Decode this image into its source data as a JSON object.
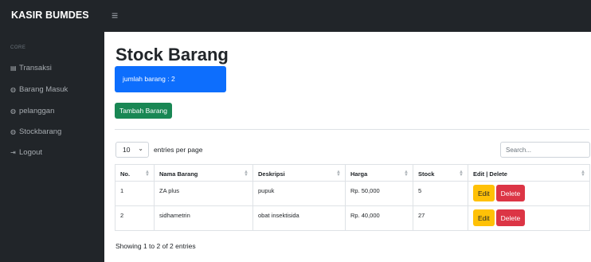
{
  "app": {
    "brand": "KASIR BUMDES",
    "toggle_icon": "hamburger-icon"
  },
  "sidebar": {
    "heading": "CORE",
    "items": [
      {
        "label": "Transaksi",
        "icon": "table-icon"
      },
      {
        "label": "Barang Masuk",
        "icon": "gauge-icon"
      },
      {
        "label": "pelanggan",
        "icon": "gauge-icon"
      },
      {
        "label": "Stockbarang",
        "icon": "gauge-icon"
      },
      {
        "label": "Logout",
        "icon": "logout-icon"
      }
    ]
  },
  "main": {
    "title": "Stock Barang",
    "count_label": "jumlah barang : 2",
    "add_button": "Tambah Barang",
    "length_value": "10",
    "length_label": "entries per page",
    "search_placeholder": "Search...",
    "table": {
      "headers": [
        "No.",
        "Nama Barang",
        "Deskripsi",
        "Harga",
        "Stock",
        "Edit | Delete"
      ],
      "rows": [
        {
          "no": "1",
          "nama": "ZA plus",
          "deskripsi": "pupuk",
          "harga": "Rp. 50,000",
          "stock": "5",
          "edit": "Edit",
          "delete": "Delete"
        },
        {
          "no": "2",
          "nama": "sidhametrin",
          "deskripsi": "obat insektisida",
          "harga": "Rp. 40,000",
          "stock": "27",
          "edit": "Edit",
          "delete": "Delete"
        }
      ]
    },
    "info": "Showing 1 to 2 of 2 entries"
  },
  "colors": {
    "sidebar_bg": "#212529",
    "primary": "#0d6efd",
    "success": "#198754",
    "warning": "#ffc107",
    "danger": "#dc3545"
  }
}
